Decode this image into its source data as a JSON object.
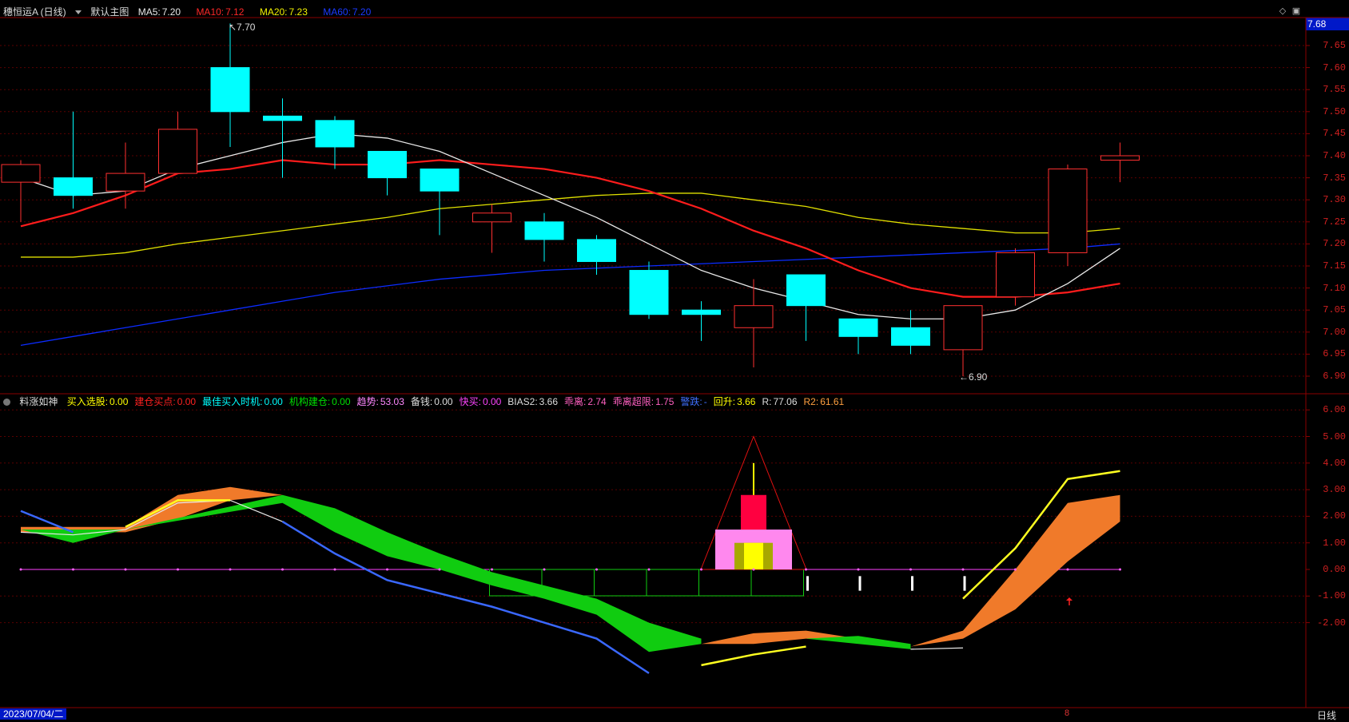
{
  "colors": {
    "bg": "#000000",
    "grid": "#7a0000",
    "up": "#ff3030",
    "down": "#00ffff",
    "ma5": "#e8e8e8",
    "ma10": "#ff1c1c",
    "ma20": "#e0e000",
    "ma60": "#0c2cff",
    "price_box": "#0018c8"
  },
  "main_header": {
    "stock": "穗恒运A (日线)",
    "template": "默认主图",
    "ma5_label": "MA5:",
    "ma5_value": "7.20",
    "ma10_label": "MA10:",
    "ma10_value": "7.12",
    "ma20_label": "MA20:",
    "ma20_value": "7.23",
    "ma60_label": "MA60:",
    "ma60_value": "7.20"
  },
  "current_price": "7.68",
  "main_axis": [
    "7.65",
    "7.60",
    "7.55",
    "7.50",
    "7.45",
    "7.40",
    "7.35",
    "7.30",
    "7.25",
    "7.20",
    "7.15",
    "7.10",
    "7.05",
    "7.00",
    "6.95",
    "6.90"
  ],
  "annotations": {
    "high": "7.70",
    "low": "6.90"
  },
  "sub_header": {
    "name": "料涨如神",
    "items": [
      {
        "label": "买入选股:",
        "value": "0.00",
        "color": "#ffff00"
      },
      {
        "label": "建仓买点:",
        "value": "0.00",
        "color": "#ff2020"
      },
      {
        "label": "最佳买入时机:",
        "value": "0.00",
        "color": "#00ffff"
      },
      {
        "label": "机构建仓:",
        "value": "0.00",
        "color": "#00e000"
      },
      {
        "label": "趋势:",
        "value": "53.03",
        "color": "#ff88ff"
      },
      {
        "label": "备钱:",
        "value": "0.00",
        "color": "#dddddd"
      },
      {
        "label": "快买:",
        "value": "0.00",
        "color": "#ff44ff"
      },
      {
        "label": "BIAS2:",
        "value": "3.66",
        "color": "#dddddd"
      },
      {
        "label": "乖离:",
        "value": "2.74",
        "color": "#ff60c0"
      },
      {
        "label": "乖离超限:",
        "value": "1.75",
        "color": "#ff60c0"
      },
      {
        "label": "警跌:",
        "value": "-",
        "color": "#4070ff"
      },
      {
        "label": "回升:",
        "value": "3.66",
        "color": "#ffff00"
      },
      {
        "label": "R:",
        "value": "77.06",
        "color": "#dddddd"
      },
      {
        "label": "R2:",
        "value": "61.61",
        "color": "#ffa040"
      }
    ]
  },
  "sub_axis": [
    "6.00",
    "5.00",
    "4.00",
    "3.00",
    "2.00",
    "1.00",
    "0.00",
    "-1.00",
    "-2.00"
  ],
  "footer": {
    "date": "2023/07/04/二",
    "period": "日线",
    "marker": "8"
  },
  "candles": [
    {
      "o": 7.34,
      "h": 7.39,
      "l": 7.25,
      "c": 7.38
    },
    {
      "o": 7.35,
      "h": 7.5,
      "l": 7.28,
      "c": 7.31
    },
    {
      "o": 7.32,
      "h": 7.43,
      "l": 7.28,
      "c": 7.36
    },
    {
      "o": 7.36,
      "h": 7.5,
      "l": 7.36,
      "c": 7.46
    },
    {
      "o": 7.6,
      "h": 7.7,
      "l": 7.42,
      "c": 7.5
    },
    {
      "o": 7.49,
      "h": 7.53,
      "l": 7.35,
      "c": 7.48
    },
    {
      "o": 7.48,
      "h": 7.49,
      "l": 7.37,
      "c": 7.42
    },
    {
      "o": 7.41,
      "h": 7.41,
      "l": 7.31,
      "c": 7.35
    },
    {
      "o": 7.37,
      "h": 7.37,
      "l": 7.22,
      "c": 7.32
    },
    {
      "o": 7.25,
      "h": 7.29,
      "l": 7.18,
      "c": 7.27
    },
    {
      "o": 7.25,
      "h": 7.27,
      "l": 7.16,
      "c": 7.21
    },
    {
      "o": 7.21,
      "h": 7.22,
      "l": 7.13,
      "c": 7.16
    },
    {
      "o": 7.14,
      "h": 7.16,
      "l": 7.03,
      "c": 7.04
    },
    {
      "o": 7.05,
      "h": 7.07,
      "l": 6.98,
      "c": 7.04
    },
    {
      "o": 7.01,
      "h": 7.12,
      "l": 6.92,
      "c": 7.06
    },
    {
      "o": 7.13,
      "h": 7.13,
      "l": 6.98,
      "c": 7.06
    },
    {
      "o": 7.03,
      "h": 7.03,
      "l": 6.95,
      "c": 6.99
    },
    {
      "o": 7.01,
      "h": 7.05,
      "l": 6.95,
      "c": 6.97
    },
    {
      "o": 6.96,
      "h": 7.06,
      "l": 6.9,
      "c": 7.06
    },
    {
      "o": 7.08,
      "h": 7.19,
      "l": 7.06,
      "c": 7.18
    },
    {
      "o": 7.18,
      "h": 7.38,
      "l": 7.15,
      "c": 7.37
    },
    {
      "o": 7.39,
      "h": 7.43,
      "l": 7.34,
      "c": 7.4
    }
  ],
  "ma5": [
    7.35,
    7.31,
    7.32,
    7.37,
    7.4,
    7.43,
    7.45,
    7.44,
    7.41,
    7.36,
    7.31,
    7.26,
    7.2,
    7.14,
    7.1,
    7.07,
    7.04,
    7.03,
    7.03,
    7.05,
    7.11,
    7.19
  ],
  "ma10": [
    7.24,
    7.27,
    7.31,
    7.36,
    7.37,
    7.39,
    7.38,
    7.38,
    7.39,
    7.38,
    7.37,
    7.35,
    7.32,
    7.28,
    7.23,
    7.19,
    7.14,
    7.1,
    7.08,
    7.08,
    7.09,
    7.11
  ],
  "ma20": [
    7.17,
    7.17,
    7.18,
    7.2,
    7.215,
    7.23,
    7.245,
    7.26,
    7.28,
    7.29,
    7.3,
    7.31,
    7.315,
    7.315,
    7.3,
    7.285,
    7.26,
    7.245,
    7.235,
    7.225,
    7.225,
    7.235
  ],
  "ma60": [
    6.97,
    6.99,
    7.01,
    7.03,
    7.05,
    7.07,
    7.09,
    7.105,
    7.12,
    7.13,
    7.14,
    7.145,
    7.15,
    7.155,
    7.16,
    7.165,
    7.17,
    7.175,
    7.18,
    7.185,
    7.19,
    7.2
  ],
  "osc_white": [
    1.4,
    1.3,
    1.5,
    2.5,
    2.6,
    1.8,
    null,
    null,
    null,
    null,
    null,
    null,
    null,
    null,
    null,
    null,
    null,
    -3.0,
    -2.95,
    null,
    null,
    null
  ],
  "osc_blue": [
    2.2,
    1.4,
    null,
    null,
    null,
    1.8,
    0.6,
    -0.4,
    -0.9,
    -1.4,
    -2.0,
    -2.6,
    -3.9,
    null,
    null,
    null,
    null,
    null,
    null,
    null,
    null,
    null
  ],
  "osc_yellow": [
    null,
    null,
    1.6,
    2.6,
    2.6,
    null,
    null,
    null,
    null,
    null,
    null,
    null,
    null,
    -3.6,
    -3.2,
    -2.9,
    null,
    null,
    -1.1,
    0.8,
    3.4,
    3.7
  ],
  "band_green": [
    {
      "i": 0,
      "a": 1.5,
      "b": 1.5
    },
    {
      "i": 1,
      "a": 1.0,
      "b": 1.5
    },
    {
      "i": 2,
      "a": 1.5,
      "b": 1.5
    },
    {
      "i": 5,
      "a": 2.5,
      "b": 2.8
    },
    {
      "i": 6,
      "a": 1.4,
      "b": 2.3
    },
    {
      "i": 7,
      "a": 0.5,
      "b": 1.4
    },
    {
      "i": 8,
      "a": 0.0,
      "b": 0.6
    },
    {
      "i": 9,
      "a": -0.6,
      "b": -0.1
    },
    {
      "i": 10,
      "a": -1.1,
      "b": -0.6
    },
    {
      "i": 11,
      "a": -1.7,
      "b": -1.1
    },
    {
      "i": 12,
      "a": -3.1,
      "b": -2.0
    },
    {
      "i": 13,
      "a": -2.8,
      "b": -2.6
    }
  ],
  "band_green2": [
    {
      "i": 15,
      "a": -2.6,
      "b": -2.6
    },
    {
      "i": 16,
      "a": -2.8,
      "b": -2.5
    },
    {
      "i": 17,
      "a": -3.0,
      "b": -2.8
    }
  ],
  "band_orange": [
    {
      "i": 0,
      "a": 1.4,
      "b": 1.6
    },
    {
      "i": 2,
      "a": 1.4,
      "b": 1.6
    },
    {
      "i": 3,
      "a": 1.9,
      "b": 2.8
    },
    {
      "i": 4,
      "a": 2.6,
      "b": 3.1
    },
    {
      "i": 5,
      "a": 2.8,
      "b": 2.8
    }
  ],
  "band_orange2": [
    {
      "i": 13,
      "a": -2.8,
      "b": -2.8
    },
    {
      "i": 14,
      "a": -2.8,
      "b": -2.4
    },
    {
      "i": 15,
      "a": -2.6,
      "b": -2.3
    },
    {
      "i": 16,
      "a": -2.6,
      "b": -2.6
    }
  ],
  "band_orange3": [
    {
      "i": 17,
      "a": -2.9,
      "b": -2.9
    },
    {
      "i": 18,
      "a": -2.6,
      "b": -2.3
    },
    {
      "i": 19,
      "a": -1.5,
      "b": 0.0
    },
    {
      "i": 20,
      "a": 0.3,
      "b": 2.5
    },
    {
      "i": 21,
      "a": 1.8,
      "b": 2.8
    }
  ]
}
